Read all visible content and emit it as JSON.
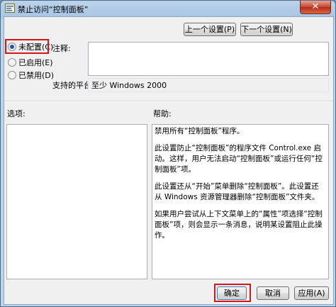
{
  "window": {
    "title": "禁止访问“控制面板”",
    "close_glyph": "✕"
  },
  "nav": {
    "prev_label": "上一个设置(P)",
    "next_label": "下一个设置(N)"
  },
  "state": {
    "options": [
      {
        "label": "未配置(C)",
        "checked": true
      },
      {
        "label": "已启用(E)",
        "checked": false
      },
      {
        "label": "已禁用(D)",
        "checked": false
      }
    ]
  },
  "comment": {
    "label": "注释:",
    "value": ""
  },
  "platform": {
    "label": "支持的平台:",
    "value": "至少 Windows 2000"
  },
  "options_section": {
    "label": "选项:"
  },
  "help_section": {
    "label": "帮助:",
    "paragraphs": [
      "禁用所有“控制面板”程序。",
      "此设置防止“控制面板”的程序文件 Control.exe 启动。这样，用户无法启动“控制面板”或运行任何“控制面板”项。",
      "此设置还从“开始”菜单删除“控制面板”。此设置还从 Windows 资源管理器删除“控制面板”文件夹。",
      "如果用户尝试从上下文菜单上的“属性”项选择“控制面板”项，则会显示一条消息，说明某设置阻止此操作。"
    ]
  },
  "footer": {
    "ok_label": "确定",
    "cancel_label": "取消",
    "apply_label": "应用(A)"
  },
  "colors": {
    "highlight_red": "#d4161c",
    "radio_selected": "#1f57a8"
  }
}
